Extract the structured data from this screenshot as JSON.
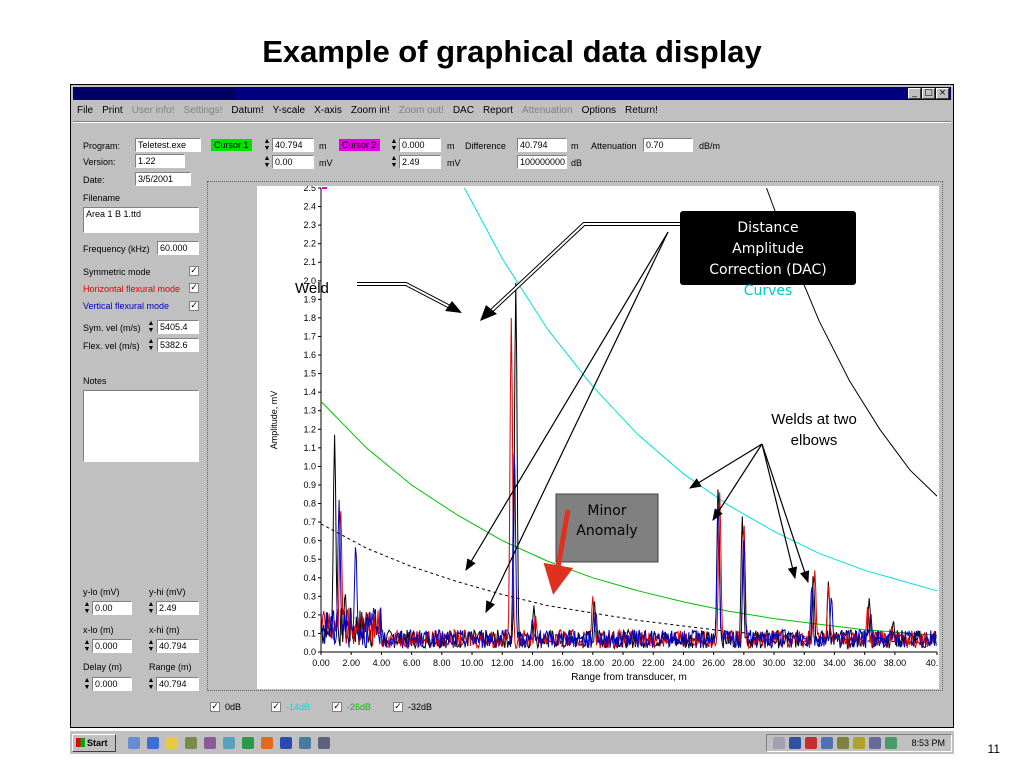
{
  "slide": {
    "title": "Example of graphical data display",
    "number": "11"
  },
  "menu": [
    "File",
    "Print",
    "User info!",
    "Settings!",
    "Datum!",
    "Y-scale",
    "X-axis",
    "Zoom in!",
    "Zoom out!",
    "DAC",
    "Report",
    "Attenuation",
    "Options",
    "Return!"
  ],
  "menu_disabled": [
    "User info!",
    "Settings!",
    "Zoom out!",
    "Attenuation"
  ],
  "info": {
    "program_label": "Program:",
    "program": "Teletest.exe",
    "version_label": "Version:",
    "version": "1.22",
    "date_label": "Date:",
    "date": "3/5/2001",
    "filename_label": "Filename",
    "filename": "Area 1 B 1.ttd",
    "frequency_label": "Frequency (kHz)",
    "frequency": "60.000",
    "sym_mode": "Symmetric mode",
    "horiz_mode": "Horizontal flexural mode",
    "vert_mode": "Vertical flexural mode",
    "sym_vel_label": "Sym. vel (m/s)",
    "sym_vel": "5405.4",
    "flex_vel_label": "Flex. vel (m/s)",
    "flex_vel": "5382.6",
    "notes_label": "Notes"
  },
  "limits": {
    "ylo_label": "y-lo (mV)",
    "ylo": "0.00",
    "yhi_label": "y-hi (mV)",
    "yhi": "2.49",
    "xlo_label": "x-lo (m)",
    "xlo": "0.000",
    "xhi_label": "x-hi (m)",
    "xhi": "40.794",
    "delay_label": "Delay (m)",
    "delay": "0.000",
    "range_label": "Range (m)",
    "range": "40.794"
  },
  "cursors": {
    "c1_label": "Cursor 1",
    "c1_m": "40.794",
    "c1_mv": "0.00",
    "c2_label": "Cursor 2",
    "c2_m": "0.000",
    "c2_mv": "2.49",
    "unit_m": "m",
    "unit_mv": "mV",
    "diff_label": "Difference",
    "diff_m": "40.794",
    "diff_db": "100000000",
    "unit_db": "dB",
    "atten_label": "Attenuation",
    "atten": "0.70",
    "atten_unit": "dB/m"
  },
  "dac_checks": [
    {
      "label": "0dB",
      "color": "#000000"
    },
    {
      "label": "-14dB",
      "color": "#00e0e0"
    },
    {
      "label": "-26dB",
      "color": "#00c000"
    },
    {
      "label": "-32dB",
      "color": "#000000"
    }
  ],
  "annotations": {
    "weld": "Weld",
    "dac": [
      "Distance",
      "Amplitude",
      "Correction (DAC)",
      "Curves"
    ],
    "minor": [
      "Minor",
      "Anomaly"
    ],
    "elbows": [
      "Welds at two",
      "elbows"
    ]
  },
  "taskbar": {
    "start": "Start",
    "clock": "8:53 PM"
  },
  "colors": {
    "symmetric": "#000000",
    "horizontal": "#e00000",
    "vertical": "#0000c0",
    "dac_0": "#000000",
    "dac_14": "#00e0e0",
    "dac_26": "#00c000",
    "dac_32": "#000000",
    "cursor1": "#00e000",
    "cursor2": "#e000e0"
  },
  "chart_data": {
    "type": "line",
    "xlabel": "Range from transducer, m",
    "ylabel": "Amplitude, mV",
    "xlim": [
      0,
      40.79
    ],
    "ylim": [
      0,
      2.5
    ],
    "x_ticks": [
      "0.00",
      "2.00",
      "4.00",
      "6.00",
      "8.00",
      "10.00",
      "12.00",
      "14.00",
      "16.00",
      "18.00",
      "20.00",
      "22.00",
      "24.00",
      "26.00",
      "28.00",
      "30.00",
      "32.00",
      "34.00",
      "36.00",
      "38.00",
      "40.79"
    ],
    "y_ticks": [
      "0.0",
      "0.1",
      "0.2",
      "0.3",
      "0.4",
      "0.5",
      "0.6",
      "0.7",
      "0.8",
      "0.9",
      "1.0",
      "1.1",
      "1.2",
      "1.3",
      "1.4",
      "1.5",
      "1.6",
      "1.7",
      "1.8",
      "1.9",
      "2.0",
      "2.1",
      "2.2",
      "2.3",
      "2.4",
      "2.5"
    ],
    "dac_curves": [
      {
        "name": "0dB",
        "points": [
          [
            29.5,
            2.5
          ],
          [
            31,
            2.17
          ],
          [
            33,
            1.78
          ],
          [
            35,
            1.46
          ],
          [
            37,
            1.2
          ],
          [
            39,
            0.98
          ],
          [
            40.79,
            0.84
          ]
        ]
      },
      {
        "name": "-14dB",
        "points": [
          [
            9.5,
            2.5
          ],
          [
            12,
            2.12
          ],
          [
            15,
            1.74
          ],
          [
            18,
            1.43
          ],
          [
            21,
            1.17
          ],
          [
            24,
            0.96
          ],
          [
            27,
            0.79
          ],
          [
            30,
            0.65
          ],
          [
            33,
            0.53
          ],
          [
            36,
            0.44
          ],
          [
            40.79,
            0.33
          ]
        ]
      },
      {
        "name": "-26dB",
        "points": [
          [
            0,
            1.35
          ],
          [
            3,
            1.1
          ],
          [
            6,
            0.9
          ],
          [
            9,
            0.74
          ],
          [
            12,
            0.6
          ],
          [
            15,
            0.49
          ],
          [
            18,
            0.4
          ],
          [
            21,
            0.33
          ],
          [
            24,
            0.27
          ],
          [
            27,
            0.22
          ],
          [
            30,
            0.18
          ],
          [
            33,
            0.15
          ],
          [
            36,
            0.12
          ],
          [
            40.79,
            0.09
          ]
        ]
      },
      {
        "name": "-32dB",
        "points": [
          [
            0,
            0.69
          ],
          [
            3,
            0.56
          ],
          [
            6,
            0.46
          ],
          [
            9,
            0.38
          ],
          [
            12,
            0.31
          ],
          [
            15,
            0.25
          ],
          [
            18,
            0.21
          ],
          [
            21,
            0.17
          ],
          [
            24,
            0.14
          ],
          [
            27,
            0.11
          ],
          [
            30,
            0.09
          ],
          [
            33,
            0.08
          ],
          [
            36,
            0.06
          ],
          [
            40.79,
            0.05
          ]
        ]
      }
    ],
    "peaks": [
      {
        "name": "symmetric",
        "color": "#000000",
        "points": [
          [
            0.3,
            0.1
          ],
          [
            0.9,
            1.17
          ],
          [
            1.6,
            0.32
          ],
          [
            12.9,
            1.99
          ],
          [
            14.1,
            0.25
          ],
          [
            18.1,
            0.28
          ],
          [
            26.3,
            0.9
          ],
          [
            27.9,
            0.73
          ],
          [
            32.6,
            0.42
          ],
          [
            33.6,
            0.38
          ],
          [
            36.3,
            0.29
          ],
          [
            37.9,
            0.17
          ]
        ]
      },
      {
        "name": "horizontal",
        "color": "#e00000",
        "points": [
          [
            1.3,
            0.78
          ],
          [
            12.6,
            1.8
          ],
          [
            14.2,
            0.2
          ],
          [
            18.0,
            0.3
          ],
          [
            26.4,
            0.86
          ],
          [
            28.0,
            0.7
          ],
          [
            32.7,
            0.44
          ],
          [
            33.6,
            0.36
          ],
          [
            36.2,
            0.25
          ],
          [
            37.8,
            0.14
          ]
        ]
      },
      {
        "name": "vertical",
        "color": "#0000c0",
        "points": [
          [
            1.2,
            0.82
          ],
          [
            2.3,
            0.58
          ],
          [
            12.8,
            1.1
          ],
          [
            14.0,
            0.18
          ],
          [
            18.2,
            0.22
          ],
          [
            26.3,
            0.8
          ],
          [
            28.0,
            0.62
          ],
          [
            32.5,
            0.36
          ],
          [
            33.8,
            0.3
          ],
          [
            36.4,
            0.21
          ],
          [
            37.7,
            0.12
          ]
        ]
      }
    ]
  }
}
